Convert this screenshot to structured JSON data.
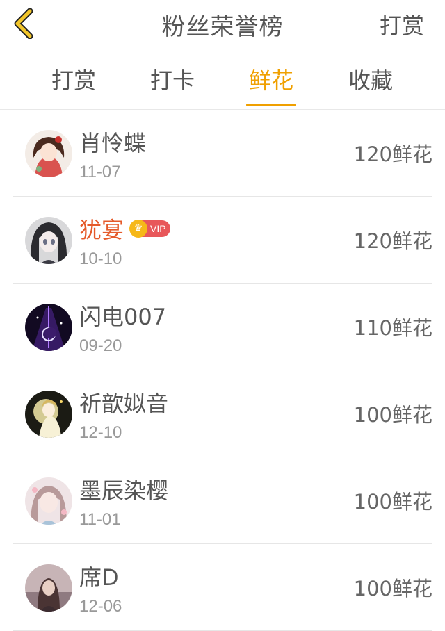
{
  "header": {
    "title": "粉丝荣誉榜",
    "right_action": "打赏"
  },
  "tabs": [
    {
      "label": "打赏",
      "active": false
    },
    {
      "label": "打卡",
      "active": false
    },
    {
      "label": "鲜花",
      "active": true
    },
    {
      "label": "收藏",
      "active": false
    }
  ],
  "colors": {
    "accent": "#f0a000",
    "vip_name": "#e55a2a",
    "vip_badge": "#e8575a"
  },
  "vip_badge_text": "VIP",
  "rows": [
    {
      "name": "肖怜蝶",
      "date": "11-07",
      "amount": "120鲜花",
      "vip": false,
      "avatar": "anime-girl-red-avatar"
    },
    {
      "name": "犹宴",
      "date": "10-10",
      "amount": "120鲜花",
      "vip": true,
      "avatar": "anime-girl-dark-hair-avatar"
    },
    {
      "name": "闪电007",
      "date": "09-20",
      "amount": "110鲜花",
      "vip": false,
      "avatar": "purple-moon-avatar"
    },
    {
      "name": "祈歆姒音",
      "date": "12-10",
      "amount": "100鲜花",
      "vip": false,
      "avatar": "anime-light-avatar"
    },
    {
      "name": "墨辰染樱",
      "date": "11-01",
      "amount": "100鲜花",
      "vip": false,
      "avatar": "anime-girl-pink-avatar"
    },
    {
      "name": "席D",
      "date": "12-06",
      "amount": "100鲜花",
      "vip": false,
      "avatar": "girl-photo-avatar"
    }
  ]
}
